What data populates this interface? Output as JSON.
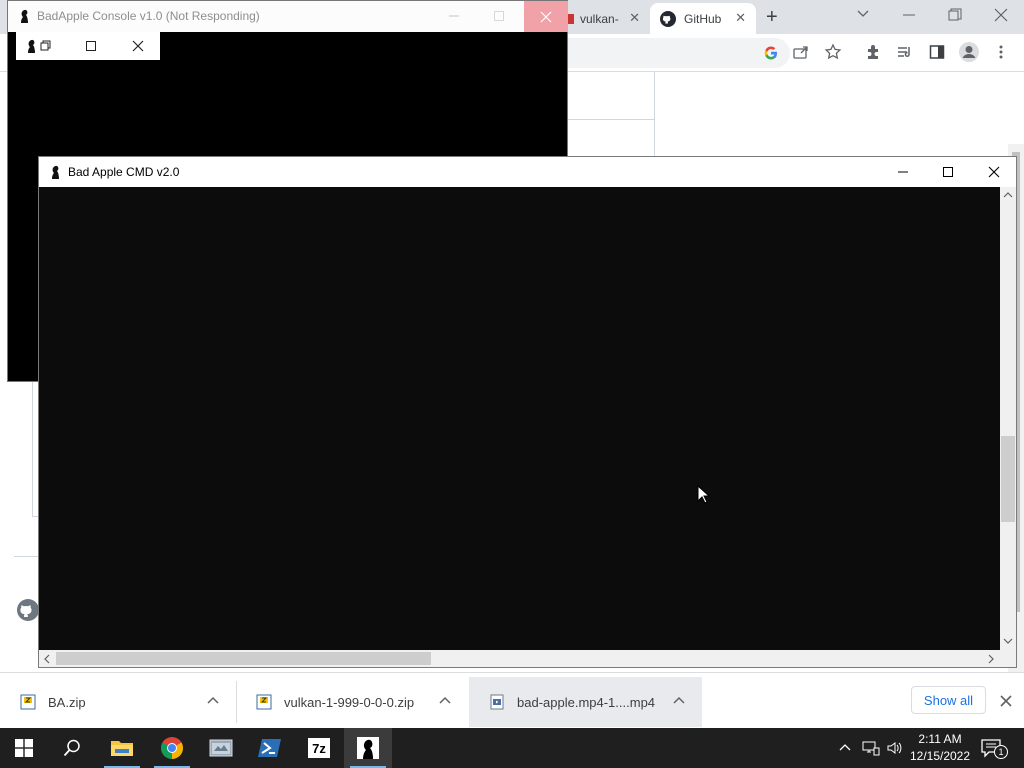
{
  "chrome": {
    "tabs": [
      {
        "title": "vulkan-",
        "active": false
      },
      {
        "title": "GitHub",
        "active": true
      }
    ],
    "tab_close_glyph": "✕",
    "new_tab_glyph": "+"
  },
  "windows": {
    "old_console": {
      "title": "BadApple Console v1.0 (Not Responding)"
    },
    "cmd": {
      "title": "Bad Apple CMD v2.0"
    }
  },
  "downloads": {
    "items": [
      {
        "name": "BA.zip",
        "icon": "archive-icon"
      },
      {
        "name": "vulkan-1-999-0-0-0.zip",
        "icon": "archive-icon"
      },
      {
        "name": "bad-apple.mp4-1....mp4",
        "icon": "video-file-icon"
      }
    ],
    "show_all_label": "Show all"
  },
  "taskbar": {
    "apps": [
      {
        "name": "start",
        "icon": "windows-start-icon"
      },
      {
        "name": "search",
        "icon": "search-icon"
      },
      {
        "name": "file-explorer",
        "icon": "folder-icon"
      },
      {
        "name": "chrome",
        "icon": "chrome-icon"
      },
      {
        "name": "app",
        "icon": "app-window-icon"
      },
      {
        "name": "powershell",
        "icon": "powershell-icon"
      },
      {
        "name": "7-zip",
        "icon": "sevenzip-icon"
      },
      {
        "name": "bad-apple",
        "icon": "bad-apple-icon"
      }
    ],
    "clock": {
      "time": "2:11 AM",
      "date": "12/15/2022"
    },
    "notification_count": "1",
    "sevenzip_label": "7z"
  },
  "colors": {
    "console_bg": "#0c0c0c",
    "taskbar_bg": "#1f1f1f",
    "chrome_tabstrip": "#dee1e6",
    "accent": "#1a73e8",
    "not_responding_close": "#f1a1a8"
  }
}
